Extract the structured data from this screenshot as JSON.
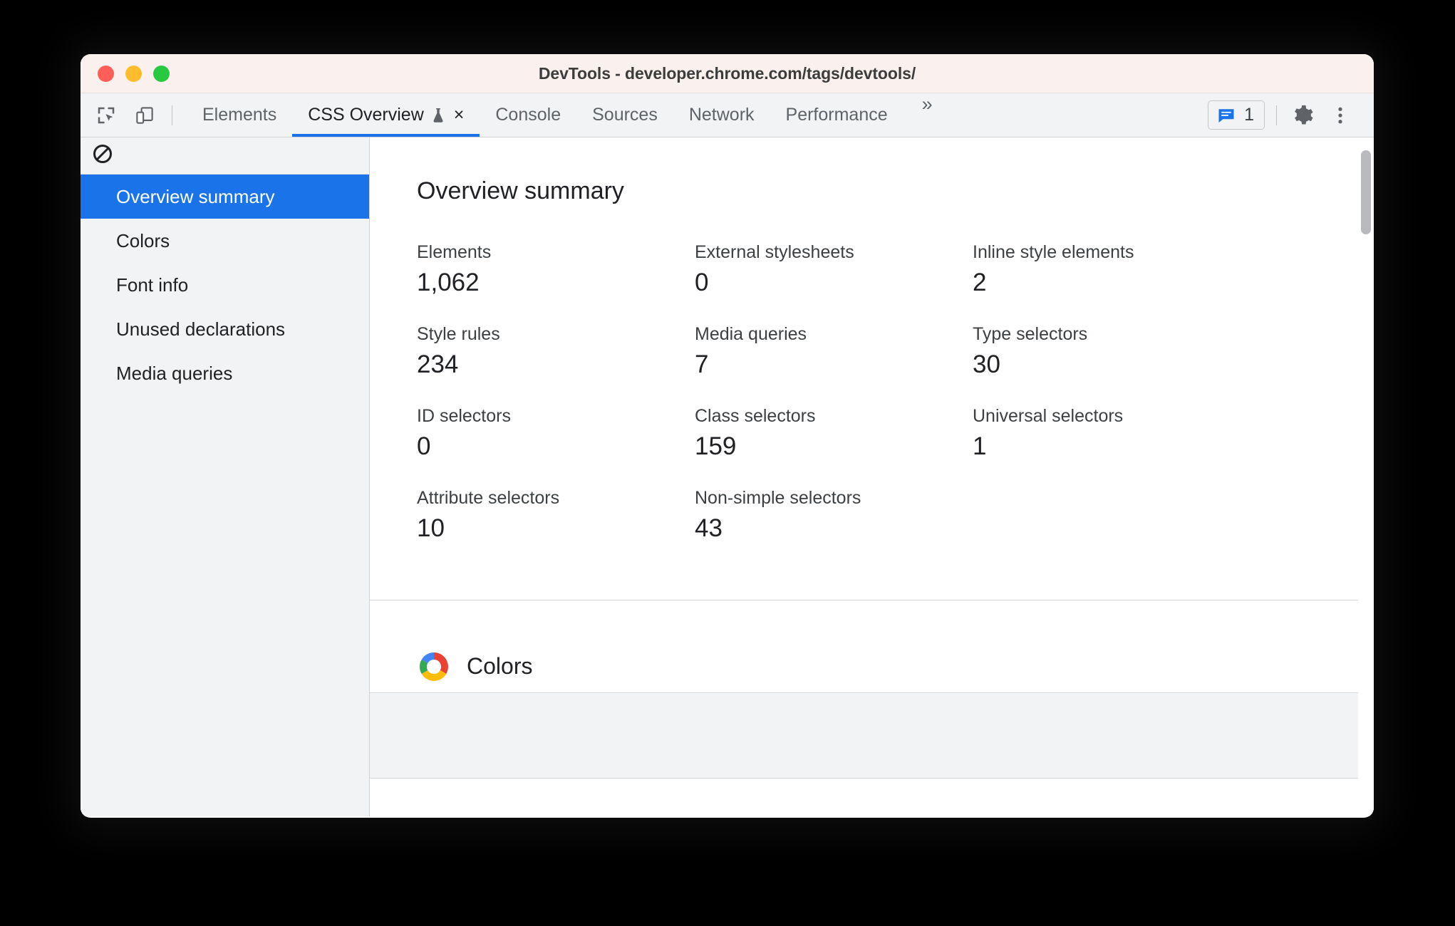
{
  "window": {
    "title": "DevTools - developer.chrome.com/tags/devtools/",
    "traffic_lights": [
      {
        "name": "close",
        "color": "#ff5f57"
      },
      {
        "name": "minimize",
        "color": "#ffbd2e"
      },
      {
        "name": "maximize",
        "color": "#28c840"
      }
    ]
  },
  "toolbar": {
    "inspect_icon": "inspect-element-icon",
    "device_icon": "device-toolbar-icon"
  },
  "tabs": [
    {
      "label": "Elements",
      "active": false
    },
    {
      "label": "CSS Overview",
      "active": true,
      "experimental": true,
      "closable": true,
      "close_label": "×"
    },
    {
      "label": "Console",
      "active": false
    },
    {
      "label": "Sources",
      "active": false
    },
    {
      "label": "Network",
      "active": false
    },
    {
      "label": "Performance",
      "active": false
    }
  ],
  "tabbar_right": {
    "more_tabs_label": "»",
    "issues_count": "1",
    "issues_icon": "issues-message-icon",
    "settings_icon": "gear-icon",
    "menu_icon": "kebab-menu-icon"
  },
  "sidebar": {
    "clear_icon": "clear-overview-icon",
    "items": [
      {
        "label": "Overview summary",
        "selected": true
      },
      {
        "label": "Colors",
        "selected": false
      },
      {
        "label": "Font info",
        "selected": false
      },
      {
        "label": "Unused declarations",
        "selected": false
      },
      {
        "label": "Media queries",
        "selected": false
      }
    ]
  },
  "main": {
    "summary_title": "Overview summary",
    "stats": [
      {
        "label": "Elements",
        "value": "1,062"
      },
      {
        "label": "External stylesheets",
        "value": "0"
      },
      {
        "label": "Inline style elements",
        "value": "2"
      },
      {
        "label": "Style rules",
        "value": "234"
      },
      {
        "label": "Media queries",
        "value": "7"
      },
      {
        "label": "Type selectors",
        "value": "30"
      },
      {
        "label": "ID selectors",
        "value": "0"
      },
      {
        "label": "Class selectors",
        "value": "159"
      },
      {
        "label": "Universal selectors",
        "value": "1"
      },
      {
        "label": "Attribute selectors",
        "value": "10"
      },
      {
        "label": "Non-simple selectors",
        "value": "43"
      }
    ],
    "colors_section": {
      "title": "Colors",
      "icon": "color-wheel-icon",
      "wheel_colors": [
        "#ea4335",
        "#fbbc04",
        "#34a853",
        "#4285f4"
      ]
    }
  },
  "theme": {
    "accent": "#1a73e8",
    "titlebar_bg": "#faf1ee",
    "chrome_bg": "#f1f3f4",
    "content_bg": "#ffffff",
    "text": "#202124",
    "muted_text": "#5f6368"
  }
}
